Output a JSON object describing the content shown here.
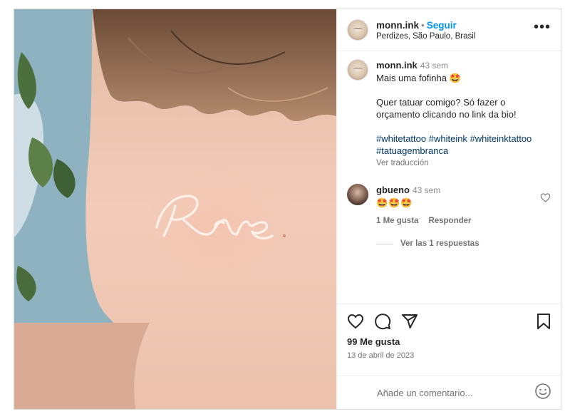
{
  "post": {
    "username": "monn.ink",
    "separator": "•",
    "follow_label": "Seguir",
    "location": "Perdizes, São Paulo, Brasil",
    "more_icon": "more-options-icon"
  },
  "caption": {
    "username": "monn.ink",
    "time": "43 sem",
    "line1": "Mais uma fofinha 🤩",
    "line2": "Quer tatuar comigo? Só fazer o orçamento clicando no link da bio!",
    "hashtags": [
      "#whitetattoo",
      "#whiteink",
      "#whiteinktattoo",
      "#tatuagembranca"
    ],
    "translate_label": "Ver traducción"
  },
  "comment": {
    "username": "gbueno",
    "time": "43 sem",
    "text": "🤩🤩🤩",
    "likes_label": "1 Me gusta",
    "reply_label": "Responder",
    "view_replies_label": "Ver las 1 respuestas"
  },
  "actions": {
    "likes": "99 Me gusta",
    "date": "13 de abril de 2023"
  },
  "add_comment": {
    "placeholder": "Añade un comentario..."
  },
  "colors": {
    "link_blue": "#0095f6",
    "hashtag_blue": "#00376b",
    "muted": "#737373"
  }
}
